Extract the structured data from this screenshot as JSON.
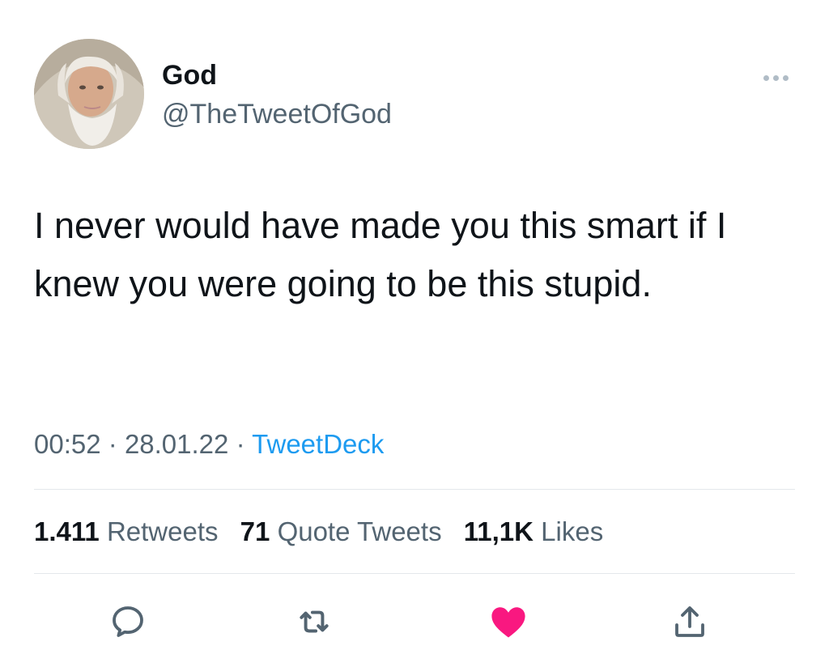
{
  "tweet": {
    "author": {
      "display_name": "God",
      "handle": "@TheTweetOfGod"
    },
    "text": "I never would have made you this smart if I knew you were going to be this stupid.",
    "time": "00:52",
    "separator": "·",
    "date": "28.01.22",
    "source": "TweetDeck",
    "stats": {
      "retweets_count": "1.411",
      "retweets_label": "Retweets",
      "quotes_count": "71",
      "quotes_label": "Quote Tweets",
      "likes_count": "11,1K",
      "likes_label": "Likes"
    },
    "liked": true
  },
  "icons": {
    "more": "more-horizontal-icon",
    "reply": "reply-icon",
    "retweet": "retweet-icon",
    "like": "heart-filled-icon",
    "share": "share-icon"
  },
  "colors": {
    "text_primary": "#0f1419",
    "text_secondary": "#536471",
    "link": "#1d9bf0",
    "like": "#f91880"
  }
}
